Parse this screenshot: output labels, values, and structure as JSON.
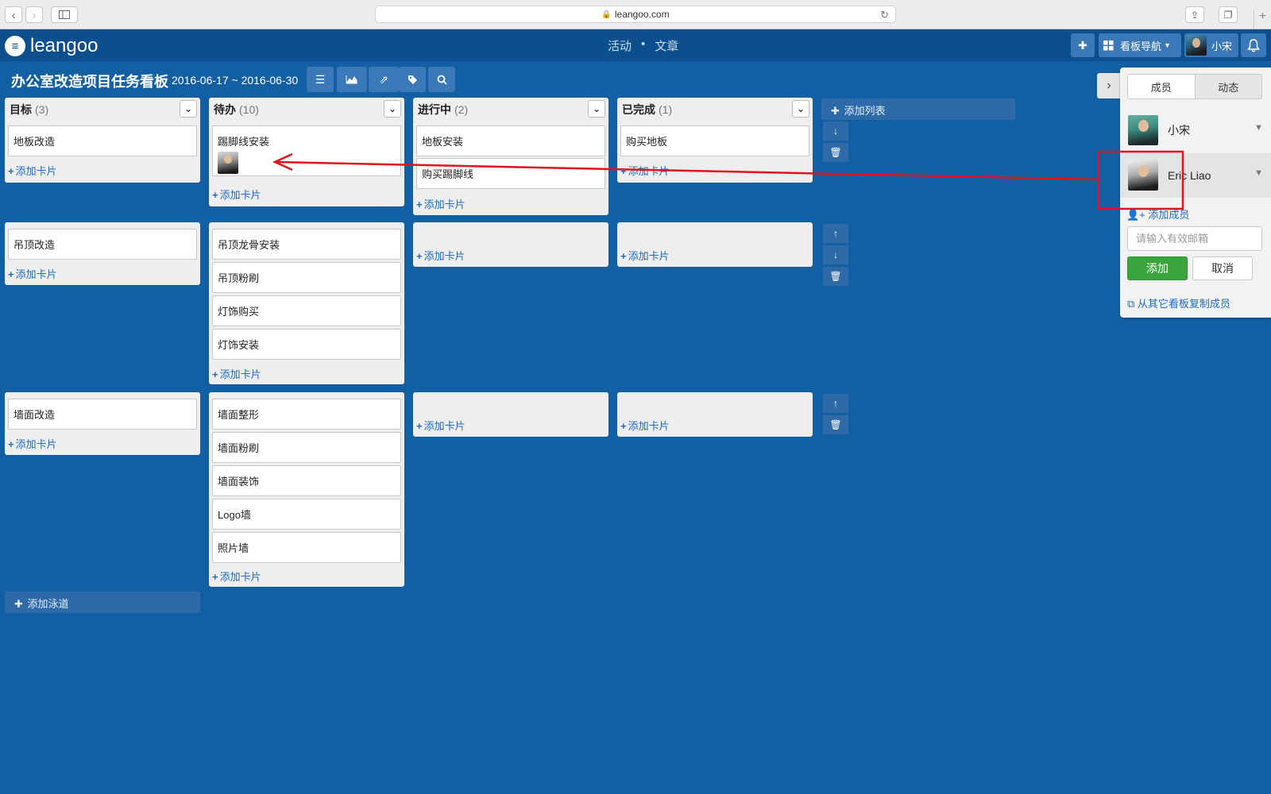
{
  "browser": {
    "url": "leangoo.com",
    "back_icon": "‹",
    "forward_icon": "›"
  },
  "header": {
    "logo_text": "leangoo",
    "nav_activity": "活动",
    "nav_dot": "•",
    "nav_article": "文章",
    "board_nav_label": "看板导航",
    "user_name": "小宋"
  },
  "board": {
    "title": "办公室改造项目任务看板",
    "dates": "2016-06-17 ~ 2016-06-30"
  },
  "add_card_label": "添加卡片",
  "add_list_label": "添加列表",
  "add_lane_label": "添加泳道",
  "columns": [
    {
      "title": "目标",
      "count": "(3)"
    },
    {
      "title": "待办",
      "count": "(10)"
    },
    {
      "title": "进行中",
      "count": "(2)"
    },
    {
      "title": "已完成",
      "count": "(1)"
    }
  ],
  "lanes": [
    {
      "cells": [
        [
          "地板改造"
        ],
        [
          "踢脚线安装"
        ],
        [
          "地板安装",
          "购买踢脚线"
        ],
        [
          "购买地板"
        ]
      ]
    },
    {
      "cells": [
        [
          "吊顶改造"
        ],
        [
          "吊顶龙骨安装",
          "吊顶粉刷",
          "灯饰购买",
          "灯饰安装"
        ],
        [],
        []
      ]
    },
    {
      "cells": [
        [
          "墙面改造"
        ],
        [
          "墙面整形",
          "墙面粉刷",
          "墙面装饰",
          "Logo墙",
          "照片墙"
        ],
        [],
        []
      ]
    }
  ],
  "panel": {
    "tab_members": "成员",
    "tab_activity": "动态",
    "members": [
      "小宋",
      "Eric Liao"
    ],
    "add_member": "添加成员",
    "email_placeholder": "请输入有效邮箱",
    "btn_add": "添加",
    "btn_cancel": "取消",
    "copy_members": "从其它看板复制成员"
  },
  "colors": {
    "board_bg": "#1260a3",
    "header_bg": "#0b4f8c",
    "link": "#1e6bc1",
    "add_button": "#3ba53d",
    "annotation": "#e0141e"
  }
}
